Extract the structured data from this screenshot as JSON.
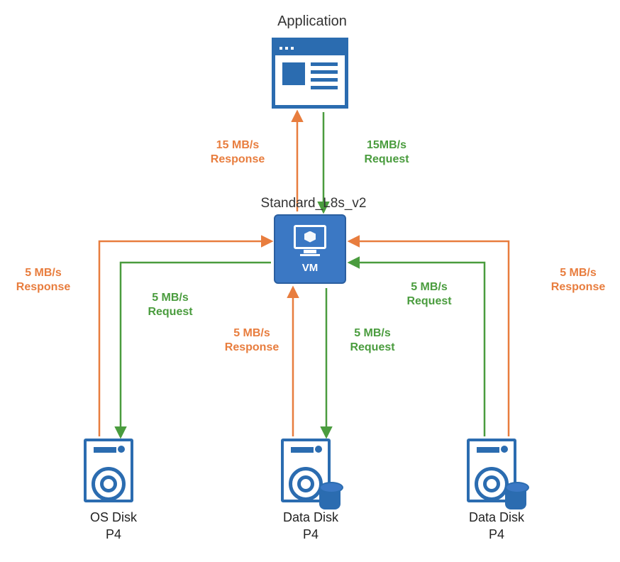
{
  "title": "Application",
  "vm": {
    "sku": "Standard_L8s_v2",
    "label": "VM"
  },
  "flows": {
    "app_response": "15 MB/s\nResponse",
    "app_request": "15MB/s\nRequest",
    "os_response": "5 MB/s\nResponse",
    "os_request": "5 MB/s\nRequest",
    "data1_response": "5 MB/s\nResponse",
    "data1_request": "5 MB/s\nRequest",
    "data2_response": "5 MB/s\nResponse",
    "data2_request": "5 MB/s\nRequest"
  },
  "disks": {
    "os": {
      "name": "OS Disk",
      "tier": "P4"
    },
    "data1": {
      "name": "Data Disk",
      "tier": "P4"
    },
    "data2": {
      "name": "Data Disk",
      "tier": "P4"
    }
  },
  "colors": {
    "request": "#4a9c3e",
    "response": "#e87d3e",
    "azure": "#2b6cb0"
  }
}
